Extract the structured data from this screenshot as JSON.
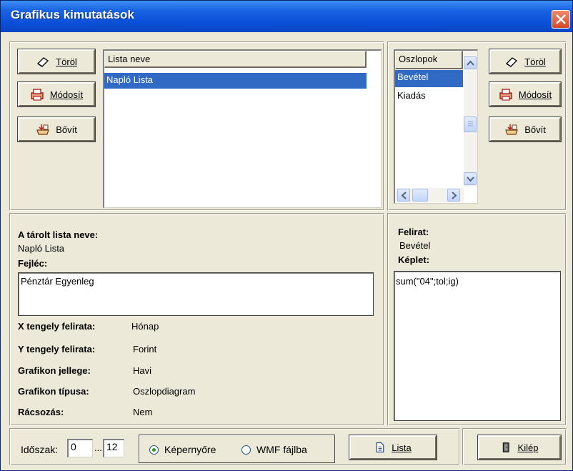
{
  "window": {
    "title": "Grafikus kimutatások"
  },
  "left_buttons": {
    "delete_label": "Töröl",
    "modify_label": "Módosít",
    "extend_label": "Bővít"
  },
  "list_view": {
    "header": "Lista neve",
    "items": [
      "Napló Lista"
    ]
  },
  "columns_list": {
    "header": "Oszlopok",
    "items": [
      "Bevétel",
      "Kiadás"
    ]
  },
  "right_buttons": {
    "delete_label": "Töröl",
    "modify_label": "Módosít",
    "extend_label": "Bővít"
  },
  "details": {
    "stored_name_label": "A tárolt lista neve:",
    "stored_name_value": "Napló Lista",
    "header_label": "Fejléc:",
    "header_value": "Pénztár Egyenleg",
    "x_axis_label": "X tengely felirata:",
    "x_axis_value": "Hónap",
    "y_axis_label": "Y tengely felirata:",
    "y_axis_value": "Forint",
    "chart_kind_label": "Grafikon jellege:",
    "chart_kind_value": "Havi",
    "chart_type_label": "Grafikon típusa:",
    "chart_type_value": "Oszlopdiagram",
    "grid_label": "Rácsozás:",
    "grid_value": "Nem"
  },
  "column_details": {
    "caption_label": "Felirat:",
    "caption_value": "Bevétel",
    "formula_label": "Képlet:",
    "formula_value": "sum(\"04\";tol;ig)"
  },
  "footer": {
    "period_label": "Időszak:",
    "period_from": "0",
    "period_sep": "...",
    "period_to": "12",
    "radio_screen": "Képernyőre",
    "radio_wmf": "WMF fájlba",
    "radio_selected": "screen",
    "list_button": "Lista",
    "exit_button": "Kilép"
  },
  "colors": {
    "title_bar": "#0b50d8",
    "selection": "#316ac5",
    "window_bg": "#ece9d8"
  }
}
